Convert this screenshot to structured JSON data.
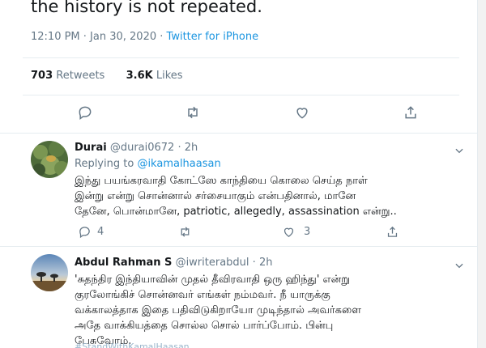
{
  "tweet": {
    "headline": "the history is not repeated.",
    "time": "12:10 PM · Jan 30, 2020",
    "source": "Twitter for iPhone",
    "retweets_count": "703",
    "retweets_label": "Retweets",
    "likes_count": "3.6K",
    "likes_label": "Likes"
  },
  "replies": [
    {
      "name": "Durai",
      "handle": "@durai0672",
      "time": "2h",
      "replying_prefix": "Replying to",
      "replying_to": "@ikamalhaasan",
      "lines": [
        "இந்து பயங்கரவாதி கோட்ஸே காந்தியை கொலை செய்த நாள்",
        "இன்று என்று சொன்னால் சர்சையாகும் என்பதினால், மானே",
        "தேனே, பொன்மானே, patriotic, allegedly, assassination என்று.."
      ],
      "reply_count": "4",
      "retweet_count": "",
      "like_count": "3"
    },
    {
      "name": "Abdul Rahman S",
      "handle": "@iwriterabdul",
      "time": "2h",
      "lines": [
        "'சுதந்திர இந்தியாவின் முதல் தீவிரவாதி ஒரு ஹிந்து' என்று",
        "குரலோங்கிச் சொன்னவர் எங்கள் நம்மவர். நீ யாருக்கு",
        "வக்காலத்தாக இதை பதிவிடுகிறாயோ முடிந்தால் அவர்களை",
        "அதே வாக்கியத்தை சொல்ல சொல் பார்ப்போம். பின்பு",
        "பேசுவோம்."
      ],
      "trailing_tags": "#StandWithKamalHaasan"
    }
  ],
  "colors": {
    "text": "#14171a",
    "muted": "#657786",
    "link": "#1b95e0",
    "divider": "#e6ecf0"
  },
  "icons": [
    "reply-icon",
    "retweet-icon",
    "like-icon",
    "share-icon",
    "chevron-down-icon"
  ]
}
